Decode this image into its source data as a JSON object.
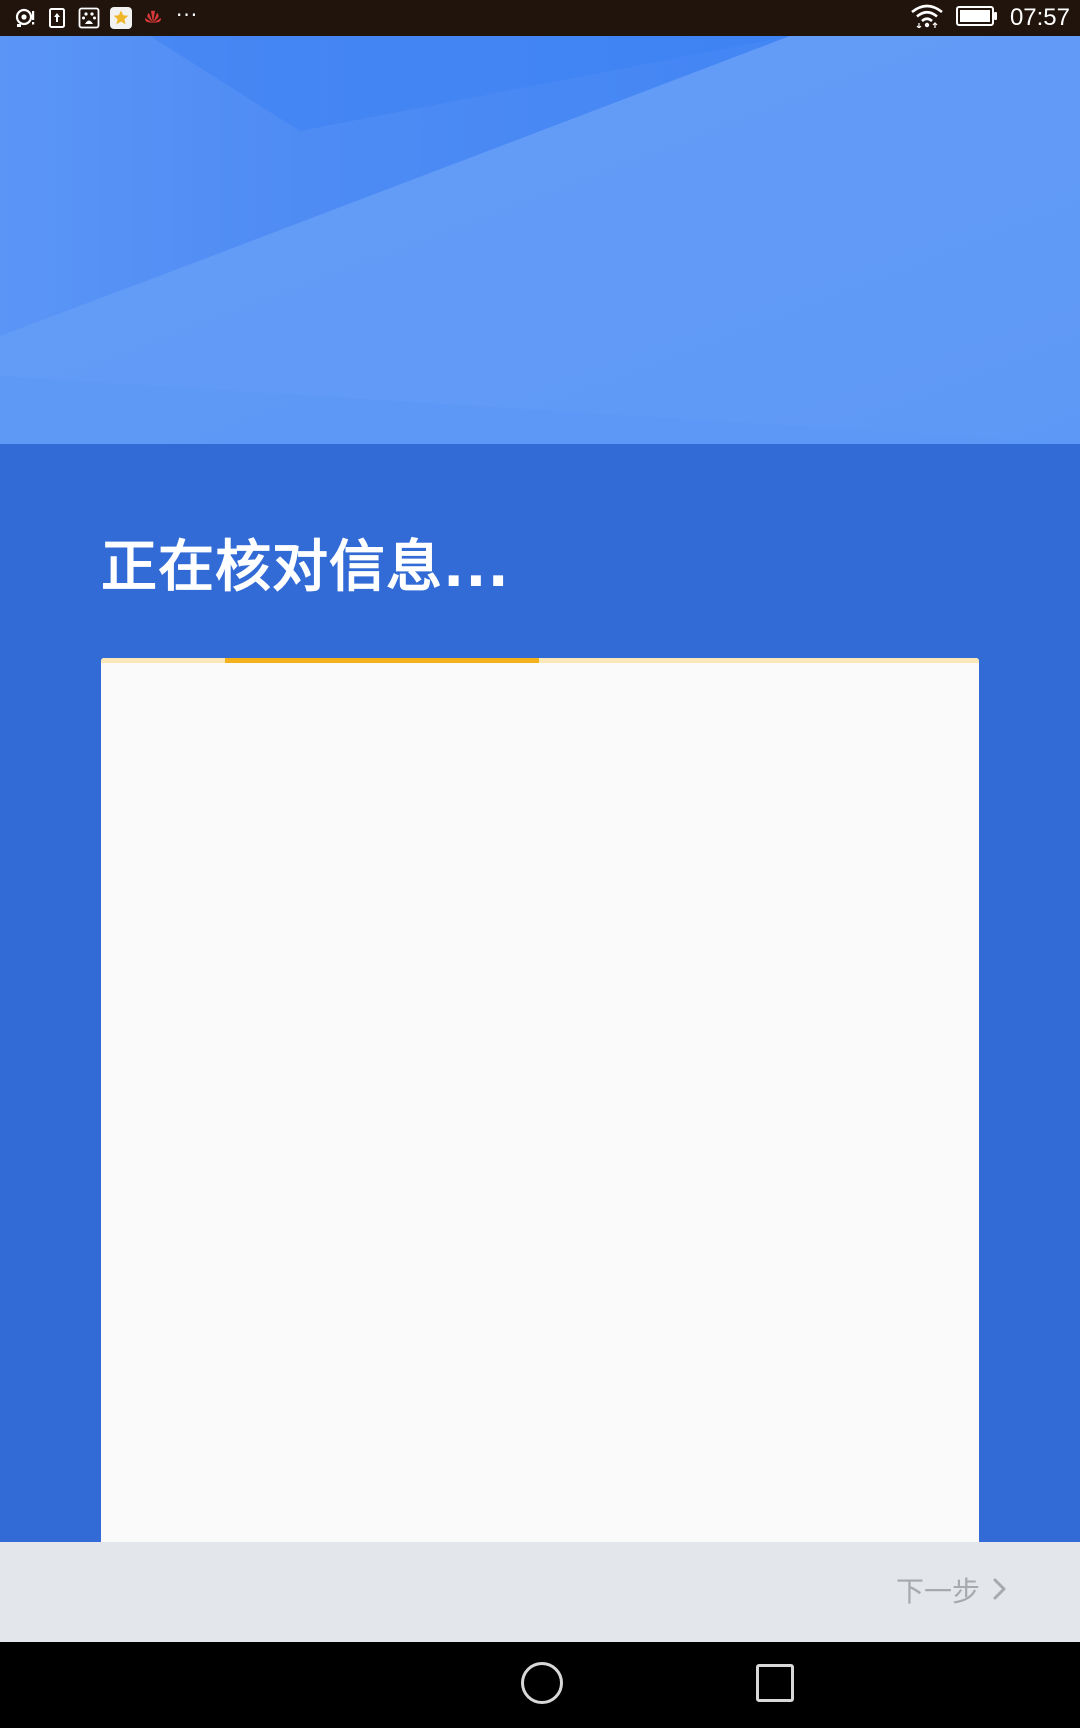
{
  "status_bar": {
    "time": "07:57",
    "left_icons": [
      "notification-ring-icon",
      "upload-icon",
      "baidu-icon",
      "star-app-icon",
      "huawei-icon"
    ],
    "overflow": "···",
    "right_icons": [
      "wifi-icon",
      "battery-icon"
    ]
  },
  "page": {
    "title": "正在核对信息..."
  },
  "progress": {
    "state": "indeterminate"
  },
  "bottom_bar": {
    "next_label": "下一步",
    "next_icon": "chevron-right-icon"
  },
  "navigation_bar": {
    "items": [
      "home-button",
      "recents-button"
    ]
  },
  "colors": {
    "status_bar": "#20140c",
    "header": "#5f99f7",
    "main": "#326bd6",
    "card": "#fafafa",
    "progress_track": "#fbe8b8",
    "progress_indicator": "#f3b21b",
    "bottom_bar": "#e3e6ea",
    "next_text": "#a7a9ac"
  }
}
